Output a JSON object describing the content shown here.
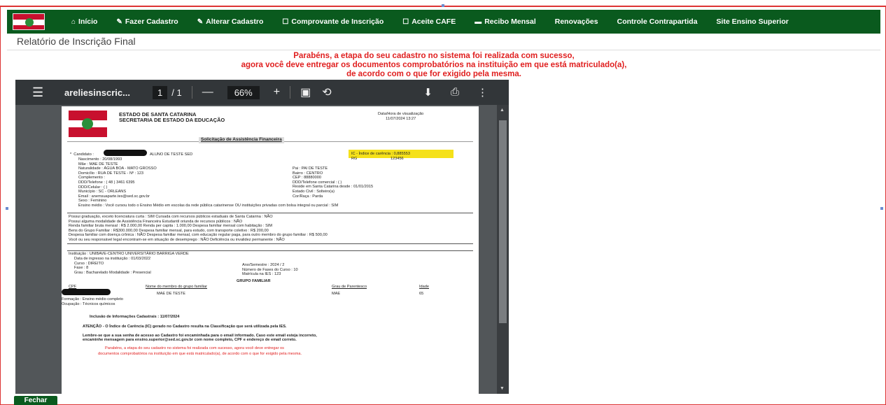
{
  "nav": {
    "items": [
      {
        "label": "Início",
        "icon": "home-icon",
        "glyph": "⌂"
      },
      {
        "label": "Fazer Cadastro",
        "icon": "edit-icon",
        "glyph": "✎"
      },
      {
        "label": "Alterar Cadastro",
        "icon": "edit-icon",
        "glyph": "✎"
      },
      {
        "label": "Comprovante de Inscrição",
        "icon": "document-icon",
        "glyph": "☐"
      },
      {
        "label": "Aceite CAFE",
        "icon": "document-icon",
        "glyph": "☐"
      },
      {
        "label": "Recibo Mensal",
        "icon": "card-icon",
        "glyph": "▬"
      },
      {
        "label": "Renovações",
        "icon": "",
        "glyph": ""
      },
      {
        "label": "Controle Contrapartida",
        "icon": "",
        "glyph": ""
      },
      {
        "label": "Site Ensino Superior",
        "icon": "",
        "glyph": ""
      }
    ],
    "background": "#0a5a1e"
  },
  "page": {
    "title": "Relatório de Inscrição Final",
    "message": [
      "Parabéns, a etapa do seu cadastro no sistema foi realizada com sucesso,",
      "agora você deve entregar os documentos comprobatórios na instituição em que está matriculado(a),",
      "de acordo com o que for exigido pela mesma."
    ],
    "close_label": "Fechar"
  },
  "viewer": {
    "filename": "areliesinscric...",
    "page_current": "1",
    "page_total": "/ 1",
    "zoom": "66%"
  },
  "doc": {
    "state": "ESTADO DE SANTA CATARINA",
    "secretaria": "SECRETARIA DE ESTADO DA EDUCAÇÃO",
    "datetime_label": "Data/Hora de visualização",
    "datetime_value": "11/07/2024 13:27",
    "title": "Solicitação de Assistência Financeira",
    "candidate_label": "Candidato",
    "candidate_value": "ALUNO DE TESTE SED",
    "ic_text": "IC - Índice de carência : 0,885553",
    "rg_label": "RG",
    "rg_value": "123456",
    "lines": [
      "Nascimento : 20/08/1993",
      "Mãe : MAE DE TESTE",
      "Naturalidade : ÁGUA BOA - MATO GROSSO",
      "Domicílio : RUA DE TESTE - Nº : 123",
      "Complemento :",
      "DDD/Telefone : ( 48 ) 3461 6395",
      "DDD/Celular : ( )",
      "Município : SC - ORLEANS",
      "Email : anemsuaparte.tes@sed.sc.gov.br",
      "Sexo : Feminino",
      "Ensino médio : Você cursou todo o Ensino Médio em escolas da rede pública catarinense OU instituições privadas com bolsa integral ou parcial : SIM"
    ],
    "right_lines": [
      "Pai : PAI DE TESTE",
      "Bairro : CENTRO",
      "CEP : 88880000",
      "DDD/Telefone comercial : ( )",
      "Reside em Santa Catarina desde : 01/01/2015",
      "Estado Civil : Solteiro(a)",
      "Cor/Raça : Parda"
    ],
    "finance": [
      "Possui graduação, exceto licenciatura curta : SIM          Cursada com recursos públicos estaduais de Santa Catarina : NÃO",
      "Possui alguma modalidade de Assistência Financeira Estudantil oriunda de recursos públicos : NÃO",
      "Renda familiar bruta mensal : R$ 2.000,00       Renda per capita : 1.000,00          Despesa familiar mensal com habitação : SIM",
      "Bens do Grupo Familiar :        R$300.000,00      Despesa familiar mensal, para estudo, com transporte coletivo : R$ 200,00",
      "Despesa familiar com doença crônica : NÃO        Despesa familiar mensal, com educação regular paga, para outro membro do grupo familiar : R$ 500,00",
      "Você ou seu responsável legal encontram-se em situação de desemprego : NÃO                    Deficiência ou invalidez permanente : NÃO"
    ],
    "institution": "Instituição : UNIBAVE-CENTRO UNIVERSITÁRIO BARRIGA VERDE",
    "inst_lines": [
      "Data de ingresso na instituição : 01/03/2022",
      "Curso : DIREITO",
      "Fase : 8",
      "Grau : Bacharelado          Modalidade : Presencial"
    ],
    "inst_right": [
      "Ano/Semestre : 2024 / 2",
      "Número de Fases do Curso : 10",
      "Matrícula na IES : 123"
    ],
    "group_title": "GRUPO FAMILIAR",
    "group_headers": [
      "CPF",
      "Nome do membro do grupo familiar",
      "Grau de Parentesco",
      "Idade"
    ],
    "group_row": [
      "",
      "MAE DE TESTE",
      "MAE",
      "65"
    ],
    "formacao": "Formação : Ensino médio completo",
    "ocupacao": "Ocupação : Técnicos químicos",
    "inclusao": "Inclusão de Informações Cadastrais :         11/07/2024",
    "atencao": "ATENÇÃO - O Índice de Carência (IC) gerado no Cadastro resulta na Classificação que será utilizada pela IES.",
    "lembre1": "Lembre-se que a sua senha de acesso ao Cadastro foi encaminhada para o email informado. Caso este email esteja incorreto,",
    "lembre2": "encaminhe mensagem para ensino.superior@sed.sc.gov.br com nome completo, CPF e endereço de email correto.",
    "final1": "Parabéns, a etapa do seu cadastro no sistema foi realizada com sucesso, agora você deve entregar os",
    "final2": "documentos comprobatórios na instituição em que está matriculado(a), de acordo com o que for exigido pela mesma."
  }
}
